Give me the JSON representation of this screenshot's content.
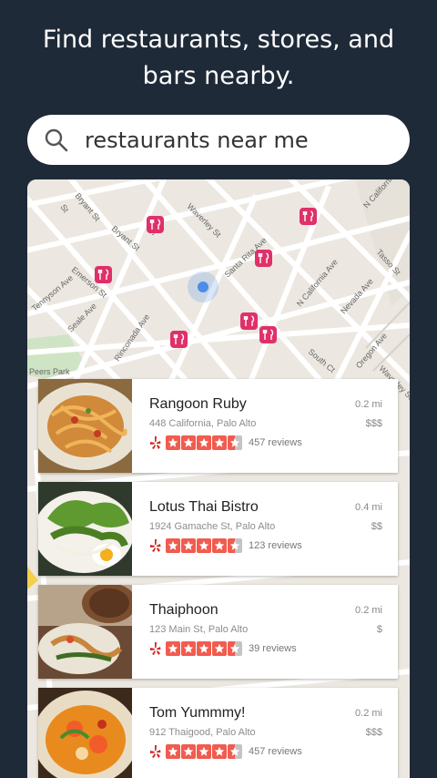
{
  "header": {
    "line1": "Find restaurants, stores, and",
    "line2": "bars nearby."
  },
  "search": {
    "query": "restaurants near me",
    "icon": "search-icon"
  },
  "map": {
    "street_labels": [
      "Bryant St",
      "Bryant St",
      "Waverley St",
      "Tennyson Ave",
      "Emerson St",
      "Seale Ave",
      "Santa Rita Ave",
      "Rinconada Ave",
      "N California Ave",
      "Nevada Ave",
      "Tasso St",
      "N California Ave",
      "Oregon Ave",
      "South Ct",
      "Peers Park",
      "Waverley St",
      "Sc",
      "St"
    ],
    "pin_icon": "restaurant-pin-icon",
    "location_icon": "current-location-dot"
  },
  "results": [
    {
      "name": "Rangoon Ruby",
      "address": "448 California, Palo Alto",
      "distance": "0.2 mi",
      "price": "$$$",
      "rating": 4.5,
      "reviews": "457 reviews"
    },
    {
      "name": "Lotus Thai Bistro",
      "address": "1924 Gamache St, Palo Alto",
      "distance": "0.4 mi",
      "price": "$$",
      "rating": 4.5,
      "reviews": "123 reviews"
    },
    {
      "name": "Thaiphoon",
      "address": "123 Main St, Palo Alto",
      "distance": "0.2 mi",
      "price": "$",
      "rating": 4.5,
      "reviews": "39 reviews"
    },
    {
      "name": "Tom Yummmy!",
      "address": "912 Thaigood, Palo Alto",
      "distance": "0.2 mi",
      "price": "$$$",
      "rating": 4.5,
      "reviews": "457 reviews"
    }
  ],
  "colors": {
    "background": "#1f2a38",
    "star": "#f15c4f",
    "pin": "#e0306a",
    "location": "#4a8ee8"
  }
}
